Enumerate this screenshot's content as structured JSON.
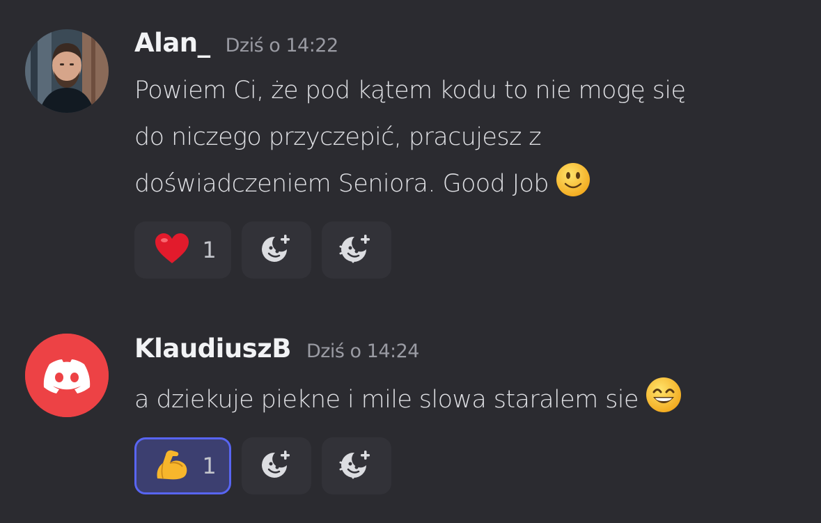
{
  "messages": [
    {
      "username": "Alan_",
      "timestamp": "Dziś o 14:22",
      "lines": [
        "Powiem Ci, że pod kątem kodu to nie mogę się",
        "do niczego przyczepić, pracujesz z",
        "doświadczeniem Seniora. Good Job"
      ],
      "inline_emoji": "slightly-smiling-face",
      "reactions": [
        {
          "emoji": "red-heart",
          "count": "1",
          "active": false
        }
      ],
      "add_buttons": [
        "add-reaction",
        "add-super-reaction"
      ]
    },
    {
      "username": "KlaudiuszB",
      "timestamp": "Dziś o 14:24",
      "lines": [
        "a dziekuje piekne i mile slowa staralem sie"
      ],
      "inline_emoji": "grinning-face-with-smiling-eyes",
      "reactions": [
        {
          "emoji": "flexed-biceps",
          "count": "1",
          "active": true
        }
      ],
      "add_buttons": [
        "add-reaction",
        "add-super-reaction"
      ]
    }
  ],
  "colors": {
    "background": "#2b2b30",
    "reaction_bg": "#323238",
    "reaction_active_bg": "#3c3f70",
    "reaction_active_border": "#5865f2",
    "discord_avatar_bg": "#ed4245",
    "username": "#f2f3f5",
    "timestamp": "#9a9ba3"
  }
}
